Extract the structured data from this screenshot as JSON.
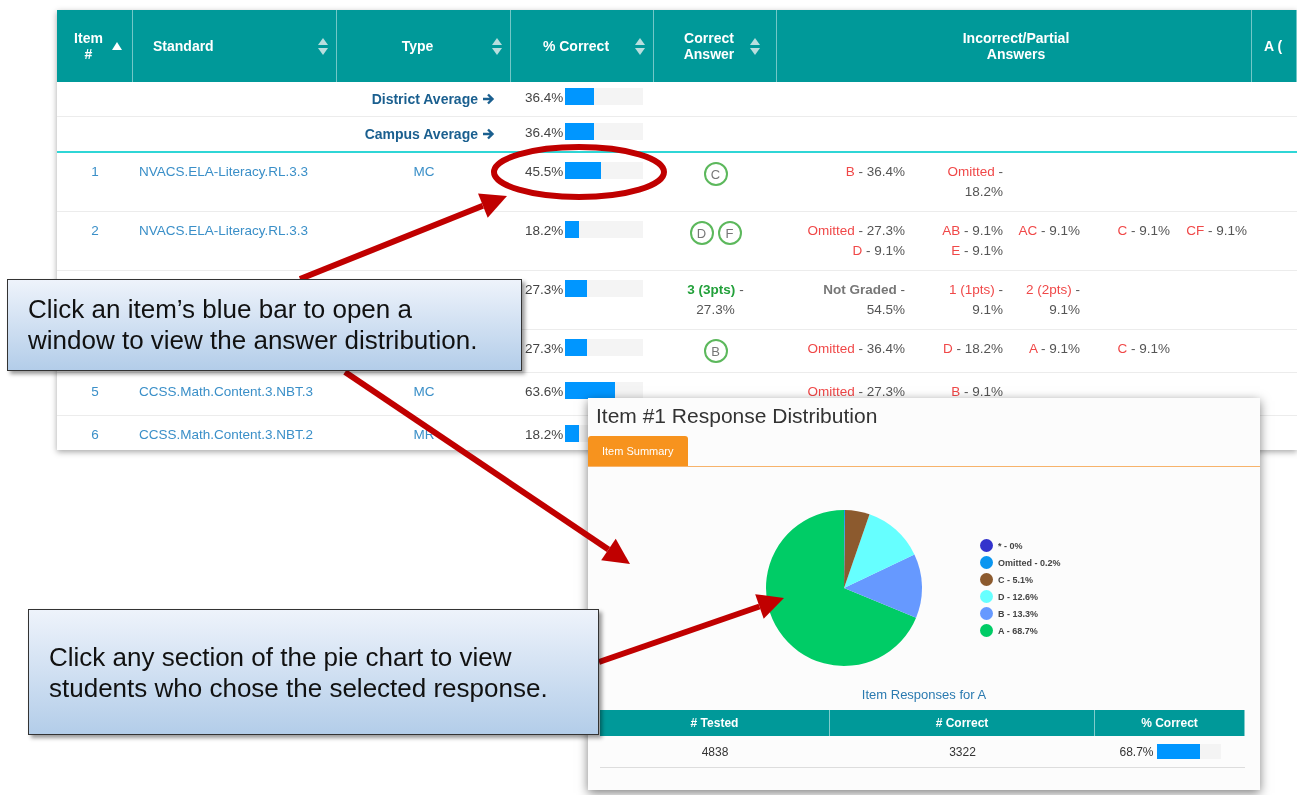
{
  "table": {
    "columns": [
      {
        "label": "Item #",
        "sorted": true
      },
      {
        "label": "Standard",
        "sorted": false
      },
      {
        "label": "Type",
        "sorted": false
      },
      {
        "label": "% Correct",
        "sorted": false
      },
      {
        "label": "Correct Answer",
        "sorted": false
      },
      {
        "label": "Incorrect/Partial Answers"
      },
      {
        "label": "A ("
      }
    ],
    "averages": [
      {
        "label": "District Average",
        "percent": "36.4%",
        "level": 0.364
      },
      {
        "label": "Campus Average",
        "percent": "36.4%",
        "level": 0.364
      }
    ],
    "rows": [
      {
        "item": "1",
        "standard": "NVACS.ELA-Literacy.RL.3.3",
        "type": "MC",
        "percent": "45.5%",
        "level": 0.455,
        "correct": {
          "kind": "letters",
          "letters": [
            "C"
          ]
        },
        "incorrect": [
          {
            "kind": "wrong",
            "label": "B",
            "value": "- 36.4%"
          },
          {
            "kind": "wrong",
            "label": "Omitted",
            "value": "- 18.2%"
          }
        ]
      },
      {
        "item": "2",
        "standard": "NVACS.ELA-Literacy.RL.3.3",
        "percent": "18.2%",
        "level": 0.182,
        "correct": {
          "kind": "letters",
          "letters": [
            "D",
            "F"
          ]
        },
        "incorrect": [
          {
            "kind": "wrong",
            "label": "Omitted",
            "value": "- 27.3%"
          },
          {
            "kind": "wrong",
            "label": "AB",
            "value": "- 9.1%"
          },
          {
            "kind": "wrong",
            "label": "AC",
            "value": "- 9.1%"
          },
          {
            "kind": "wrong",
            "label": "C",
            "value": "- 9.1%"
          },
          {
            "kind": "wrong",
            "label": "CF",
            "value": "- 9.1%"
          },
          {
            "kind": "wrong",
            "label": "D",
            "value": "- 9.1%"
          },
          {
            "kind": "wrong",
            "label": "E",
            "value": "- 9.1%"
          }
        ]
      },
      {
        "percent": "27.3%",
        "level": 0.273,
        "correct": {
          "kind": "points",
          "label": "3 (3pts)",
          "value": "- 27.3%"
        },
        "incorrect": [
          {
            "kind": "ungraded",
            "label": "Not Graded",
            "value": "- 54.5%"
          },
          {
            "kind": "wrong",
            "label": "1 (1pts)",
            "value": "- 9.1%"
          },
          {
            "kind": "wrong",
            "label": "2 (2pts)",
            "value": "- 9.1%"
          }
        ]
      },
      {
        "percent": "27.3%",
        "level": 0.273,
        "correct": {
          "kind": "letters",
          "letters": [
            "B"
          ]
        },
        "incorrect": [
          {
            "kind": "wrong",
            "label": "Omitted",
            "value": "- 36.4%"
          },
          {
            "kind": "wrong",
            "label": "D",
            "value": "- 18.2%"
          },
          {
            "kind": "wrong",
            "label": "A",
            "value": "- 9.1%"
          },
          {
            "kind": "wrong",
            "label": "C",
            "value": "- 9.1%"
          }
        ]
      },
      {
        "item": "5",
        "standard": "CCSS.Math.Content.3.NBT.3",
        "type": "MC",
        "percent": "63.6%",
        "level": 0.636,
        "incorrect": [
          {
            "kind": "wrong",
            "label": "Omitted",
            "value": "- 27.3%"
          },
          {
            "kind": "wrong",
            "label": "B",
            "value": "- 9.1%"
          }
        ]
      },
      {
        "item": "6",
        "standard": "CCSS.Math.Content.3.NBT.2",
        "type": "MR",
        "percent": "18.2%",
        "level": 0.182
      }
    ]
  },
  "popup": {
    "title": "Item #1 Response Distribution",
    "tabs": [
      {
        "label": "Item Summary",
        "selected": true
      }
    ],
    "chart_data": {
      "type": "pie",
      "values": [
        0,
        0.2,
        5.1,
        12.6,
        13.3,
        68.7
      ]
    },
    "legend": [
      {
        "label": "* - 0%",
        "color": "#3333cc"
      },
      {
        "label": "Omitted - 0.2%",
        "color": "#0a96f0"
      },
      {
        "label": "C - 5.1%",
        "color": "#8c5a2e"
      },
      {
        "label": "D - 12.6%",
        "color": "#66ffff"
      },
      {
        "label": "B - 13.3%",
        "color": "#6699ff"
      },
      {
        "label": "A - 68.7%",
        "color": "#00cc66"
      }
    ],
    "caption": "Item Responses for A",
    "stats": {
      "columns": [
        "# Tested",
        "# Correct",
        "% Correct"
      ],
      "values": [
        {
          "text": "4838"
        },
        {
          "text": "3322"
        },
        {
          "text": "68.7%",
          "level": 0.687
        }
      ]
    }
  },
  "callouts": [
    "Click an item’s blue bar to open a window to view the answer distribution.",
    "Click any section of the pie chart to view students who chose the selected response."
  ]
}
